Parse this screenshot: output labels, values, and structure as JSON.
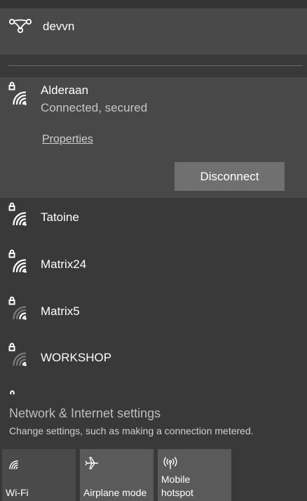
{
  "vpn": {
    "label": "devvn"
  },
  "connected_network": {
    "name": "Alderaan",
    "status": "Connected, secured",
    "properties_label": "Properties",
    "disconnect_label": "Disconnect"
  },
  "networks": [
    {
      "name": "Tatoine",
      "signal": 4,
      "secured": true
    },
    {
      "name": "Matrix24",
      "signal": 4,
      "secured": true
    },
    {
      "name": "Matrix5",
      "signal": 2,
      "secured": true
    },
    {
      "name": "WORKSHOP",
      "signal": 1,
      "secured": true
    }
  ],
  "settings": {
    "title": "Network & Internet settings",
    "subtitle": "Change settings, such as making a connection metered."
  },
  "tiles": {
    "wifi": "Wi-Fi",
    "airplane": "Airplane mode",
    "hotspot": "Mobile\nhotspot"
  },
  "colors": {
    "background": "#393939",
    "selected": "#484848",
    "button": "#707070",
    "tile": "#5a5a5a"
  }
}
